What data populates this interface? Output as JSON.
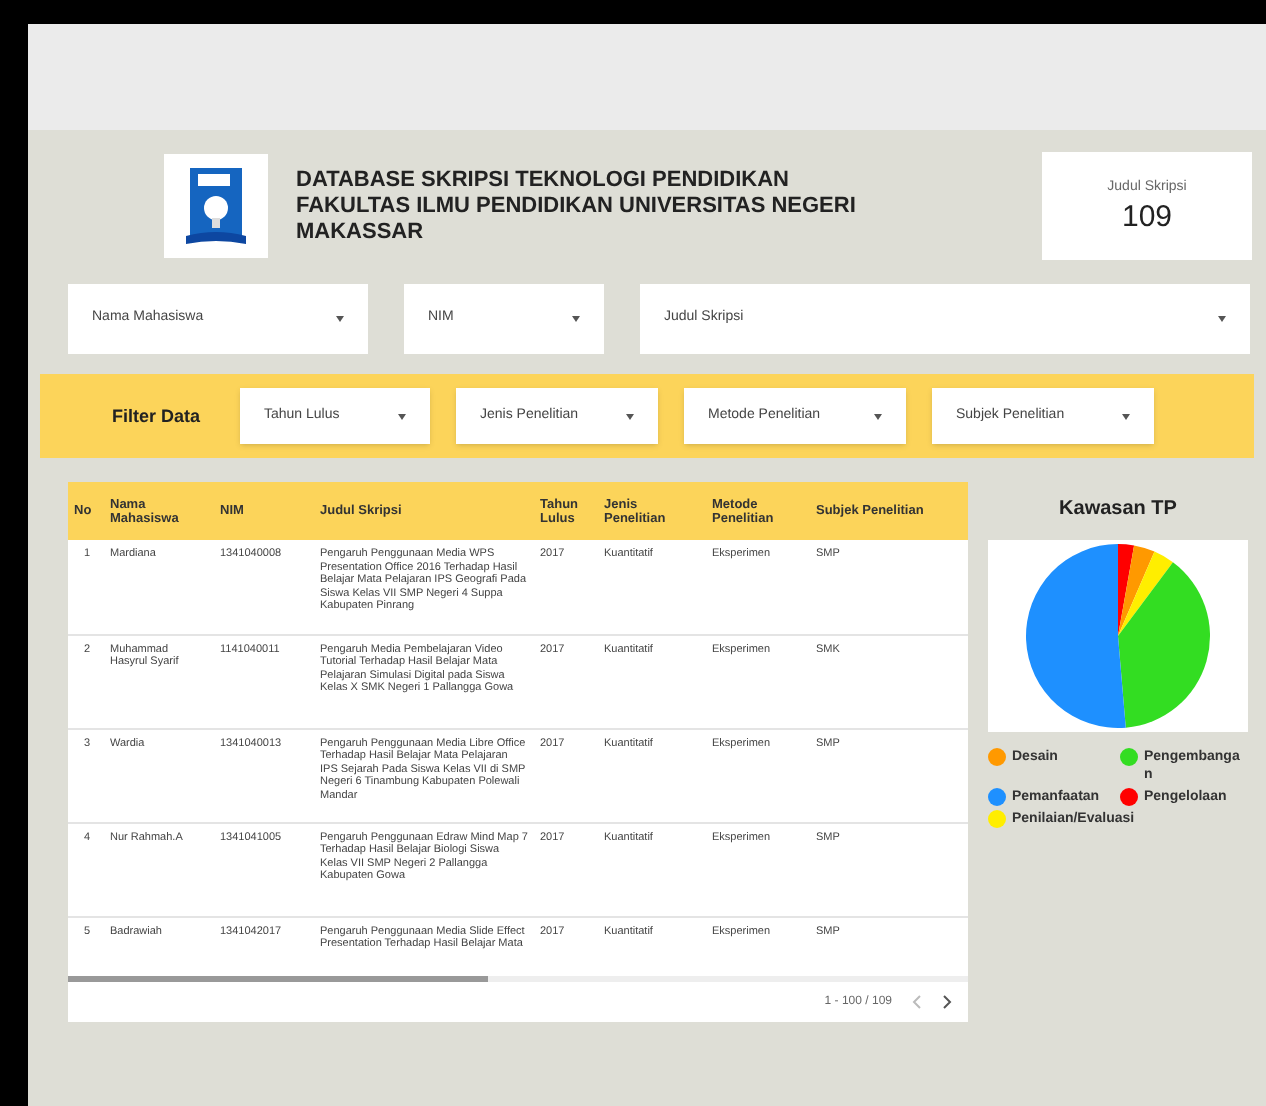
{
  "header": {
    "title": "DATABASE SKRIPSI TEKNOLOGI PENDIDIKAN FAKULTAS ILMU PENDIDIKAN UNIVERSITAS NEGERI MAKASSAR",
    "scorecard": {
      "label": "Judul Skripsi",
      "value": "109"
    }
  },
  "top_filters": [
    "Nama Mahasiswa",
    "NIM",
    "Judul Skripsi"
  ],
  "filter_bar": {
    "label": "Filter Data",
    "dropdowns": [
      "Tahun Lulus",
      "Jenis Penelitian",
      "Metode Penelitian",
      "Subjek Penelitian"
    ]
  },
  "table": {
    "columns": [
      "No",
      "Nama Mahasiswa",
      "NIM",
      "Judul Skripsi",
      "Tahun Lulus",
      "Jenis Penelitian",
      "Metode Penelitian",
      "Subjek Penelitian"
    ],
    "rows": [
      [
        "1",
        "Mardiana",
        "1341040008",
        "Pengaruh Penggunaan Media WPS Presentation Office 2016 Terhadap Hasil Belajar Mata Pelajaran IPS Geografi Pada Siswa Kelas VII SMP Negeri 4 Suppa Kabupaten Pinrang",
        "2017",
        "Kuantitatif",
        "Eksperimen",
        "SMP"
      ],
      [
        "2",
        "Muhammad Hasyrul Syarif",
        "1141040011",
        "Pengaruh Media Pembelajaran Video Tutorial Terhadap Hasil Belajar Mata Pelajaran Simulasi Digital pada Siswa Kelas X SMK Negeri 1 Pallangga Gowa",
        "2017",
        "Kuantitatif",
        "Eksperimen",
        "SMK"
      ],
      [
        "3",
        "Wardia",
        "1341040013",
        "Pengaruh Penggunaan Media Libre Office Terhadap Hasil Belajar Mata Pelajaran IPS Sejarah Pada Siswa Kelas VII di SMP Negeri 6 Tinambung Kabupaten Polewali Mandar",
        "2017",
        "Kuantitatif",
        "Eksperimen",
        "SMP"
      ],
      [
        "4",
        "Nur Rahmah.A",
        "1341041005",
        "Pengaruh Penggunaan Edraw Mind Map 7 Terhadap Hasil Belajar Biologi Siswa Kelas VII SMP Negeri 2 Pallangga Kabupaten Gowa",
        "2017",
        "Kuantitatif",
        "Eksperimen",
        "SMP"
      ],
      [
        "5",
        "Badrawiah",
        "1341042017",
        "Pengaruh Penggunaan Media Slide Effect Presentation Terhadap Hasil Belajar Mata",
        "2017",
        "Kuantitatif",
        "Eksperimen",
        "SMP"
      ]
    ],
    "pagination": "1 - 100 / 109"
  },
  "chart": {
    "title": "Kawasan TP",
    "chart_data": {
      "type": "pie",
      "categories": [
        "Desain",
        "Pengembangan",
        "Pemanfaatan",
        "Pengelolaan",
        "Penilaian/Evaluasi"
      ],
      "values": [
        3.7,
        38.5,
        51.4,
        2.8,
        3.7
      ],
      "colors": [
        "#ff9900",
        "#33dd22",
        "#1e90ff",
        "#ff0000",
        "#ffee00"
      ]
    }
  }
}
